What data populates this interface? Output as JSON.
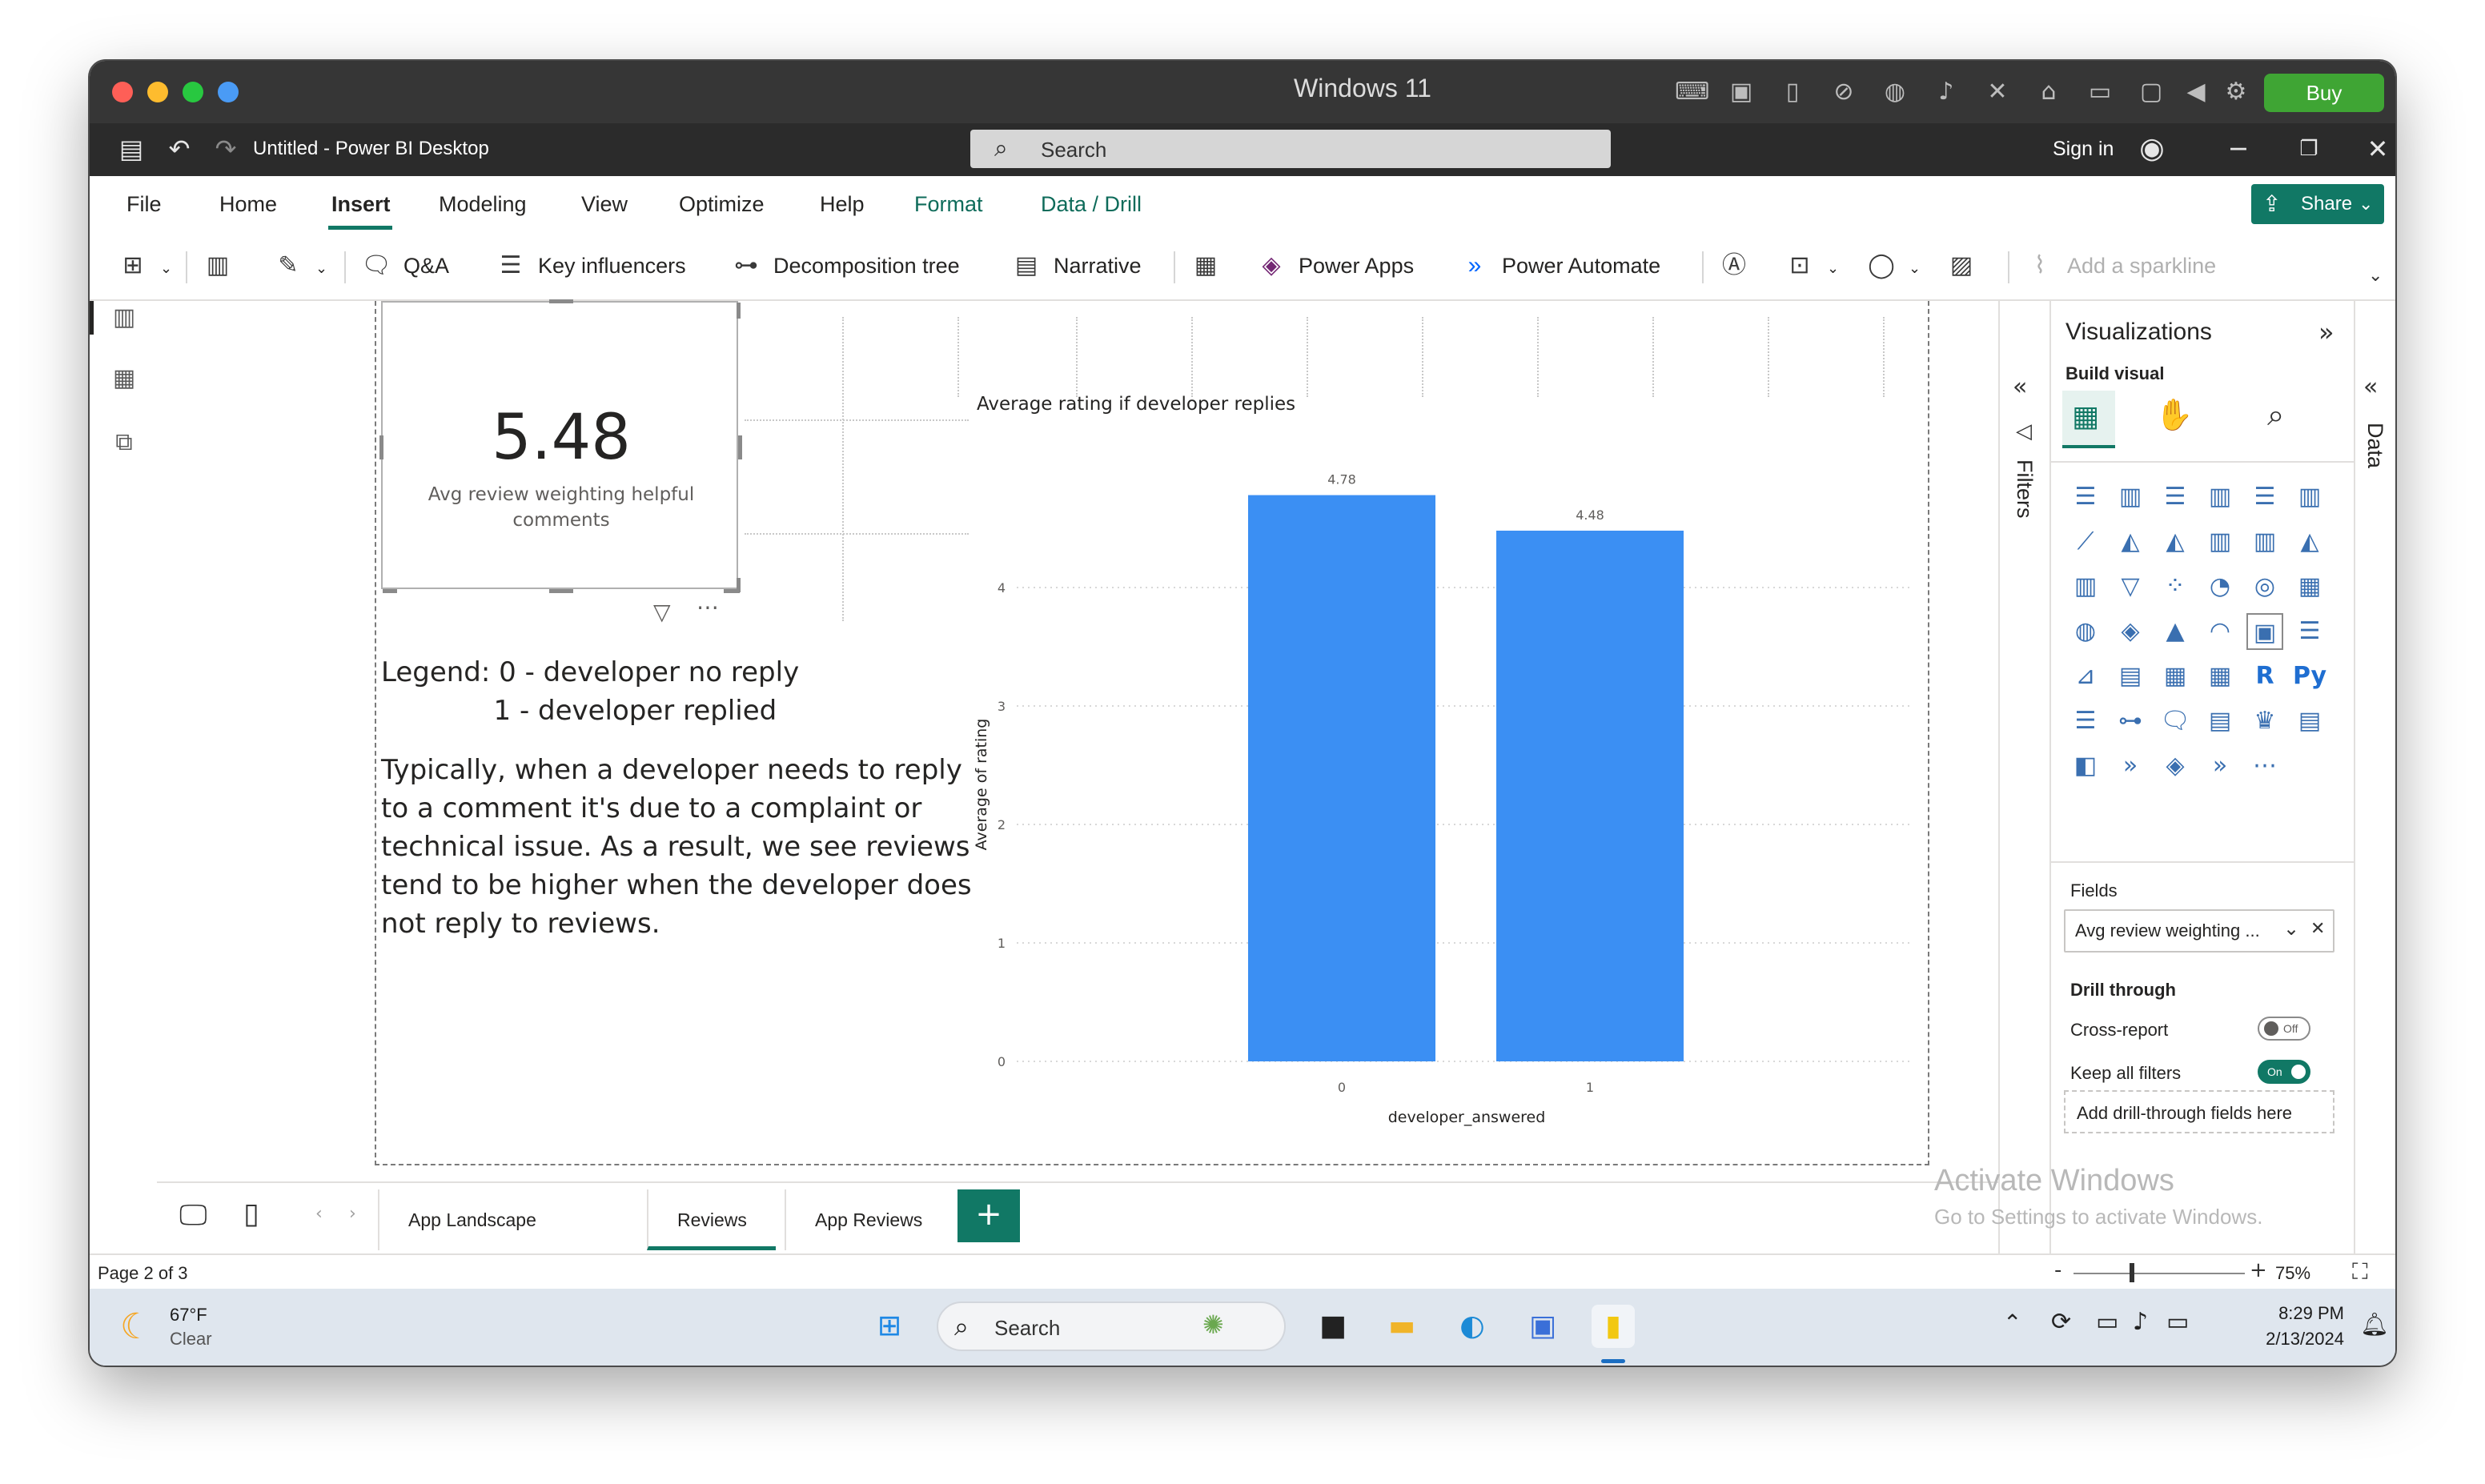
{
  "mac": {
    "title": "Windows 11",
    "buy_label": "Buy"
  },
  "app": {
    "doc_title": "Untitled - Power BI Desktop",
    "search_placeholder": "Search",
    "sign_in": "Sign in",
    "share_label": "Share"
  },
  "menu": {
    "tabs": [
      "File",
      "Home",
      "Insert",
      "Modeling",
      "View",
      "Optimize",
      "Help",
      "Format",
      "Data / Drill"
    ],
    "active": "Insert"
  },
  "ribbon": {
    "qa": "Q&A",
    "key_influencers": "Key influencers",
    "decomposition_tree": "Decomposition tree",
    "narrative": "Narrative",
    "power_apps": "Power Apps",
    "power_automate": "Power Automate",
    "add_sparkline": "Add a sparkline"
  },
  "card": {
    "value": "5.48",
    "label": "Avg review weighting helpful comments"
  },
  "legend_text": {
    "line1": "Legend: 0 - developer no reply",
    "line2": "             1 - developer replied"
  },
  "body_text": "Typically, when a developer needs to reply to a comment it's due to a complaint or technical issue. As a result, we see reviews tend to be higher when the developer does not reply to reviews.",
  "chart_data": {
    "type": "bar",
    "title": "Average rating if developer replies",
    "xlabel": "developer_answered",
    "ylabel": "Average of rating",
    "categories": [
      "0",
      "1"
    ],
    "values": [
      4.78,
      4.48
    ],
    "data_labels": [
      "4.78",
      "4.48"
    ],
    "ylim": [
      0,
      5
    ],
    "yticks": [
      "0",
      "1",
      "2",
      "3",
      "4"
    ],
    "color": "#3b8ff3",
    "grid": true
  },
  "panes": {
    "filters_label": "Filters",
    "data_label": "Data",
    "viz_title": "Visualizations",
    "build_visual": "Build visual",
    "fields_label": "Fields",
    "field_value": "Avg review weighting ...",
    "drill_through": "Drill through",
    "cross_report": "Cross-report",
    "cross_report_state": "Off",
    "keep_all_filters": "Keep all filters",
    "keep_all_filters_state": "On",
    "add_drill_through": "Add drill-through fields here"
  },
  "pages": {
    "tabs": [
      "App Landscape",
      "Reviews",
      "App Reviews"
    ],
    "active": "Reviews",
    "indicator": "Page 2 of 3",
    "zoom": "75%"
  },
  "activate": {
    "title": "Activate Windows",
    "subtitle": "Go to Settings to activate Windows."
  },
  "taskbar": {
    "temp": "67°F",
    "weather": "Clear",
    "search": "Search",
    "time": "8:29 PM",
    "date": "2/13/2024"
  },
  "colors": {
    "accent": "#117865",
    "bar": "#3b8ff3",
    "mac_bar": "#363636",
    "title_bar": "#2b2b2b"
  }
}
